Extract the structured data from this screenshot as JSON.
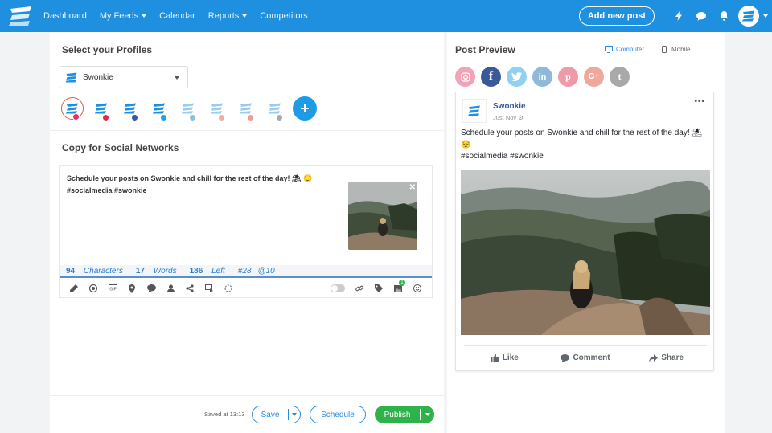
{
  "nav": {
    "items": [
      {
        "label": "Dashboard"
      },
      {
        "label": "My Feeds"
      },
      {
        "label": "Calendar"
      },
      {
        "label": "Reports"
      },
      {
        "label": "Competitors"
      }
    ],
    "add_post_label": "Add new post",
    "colors": {
      "bar": "#1f8fe0"
    }
  },
  "left": {
    "profiles_title": "Select your Profiles",
    "profile_select_value": "Swonkie",
    "profile_avatar_text": "swonkie",
    "profile_badges": [
      {
        "network": "instagram",
        "color": "#e1306c"
      },
      {
        "network": "pinterest",
        "color": "#e0284a"
      },
      {
        "network": "facebook",
        "color": "#3b5998"
      },
      {
        "network": "twitter",
        "color": "#1da1f2"
      },
      {
        "network": "linkedin",
        "color": "#0077b5"
      },
      {
        "network": "google-plus",
        "color": "#dd4b39"
      },
      {
        "network": "youtube",
        "color": "#e62117"
      },
      {
        "network": "tumblr",
        "color": "#35465c"
      }
    ],
    "copy_title": "Copy for Social Networks",
    "post_text_line1": "Schedule your posts on Swonkie and chill for the rest of the day! ⛱ 😌",
    "post_text_line2": "#socialmedia #swonkie",
    "stats": {
      "characters_num": "94",
      "characters_word": "Characters",
      "words_num": "17",
      "words_word": "Words",
      "left_num": "186",
      "left_word": "Left",
      "hashtags": "#28",
      "mentions": "@10"
    },
    "gallery_badge": "1",
    "saved_text": "Saved at 13:13",
    "save_label": "Save",
    "schedule_label": "Schedule",
    "publish_label": "Publish"
  },
  "right": {
    "preview_title": "Post Preview",
    "computer_label": "Computer",
    "mobile_label": "Mobile",
    "networks": [
      {
        "name": "instagram",
        "color": "#f2a3b8",
        "glyph": "◎"
      },
      {
        "name": "facebook",
        "color": "#3b5998",
        "glyph": "f"
      },
      {
        "name": "twitter",
        "color": "#8fd0f3",
        "glyph": "t"
      },
      {
        "name": "linkedin",
        "color": "#8fb9d9",
        "glyph": "in"
      },
      {
        "name": "pinterest",
        "color": "#f09aa8",
        "glyph": "p"
      },
      {
        "name": "google-plus",
        "color": "#f0a89c",
        "glyph": "G+"
      },
      {
        "name": "tumblr",
        "color": "#a9a9a9",
        "glyph": "t"
      }
    ],
    "fb": {
      "name": "Swonkie",
      "time": "Just Nov ⚙",
      "more": "•••",
      "text_line1": "Schedule your posts on Swonkie and chill for the rest of the day! ⛱",
      "text_line2": "😌",
      "text_line3": "#socialmedia #swonkie",
      "like_label": "Like",
      "comment_label": "Comment",
      "share_label": "Share"
    }
  }
}
